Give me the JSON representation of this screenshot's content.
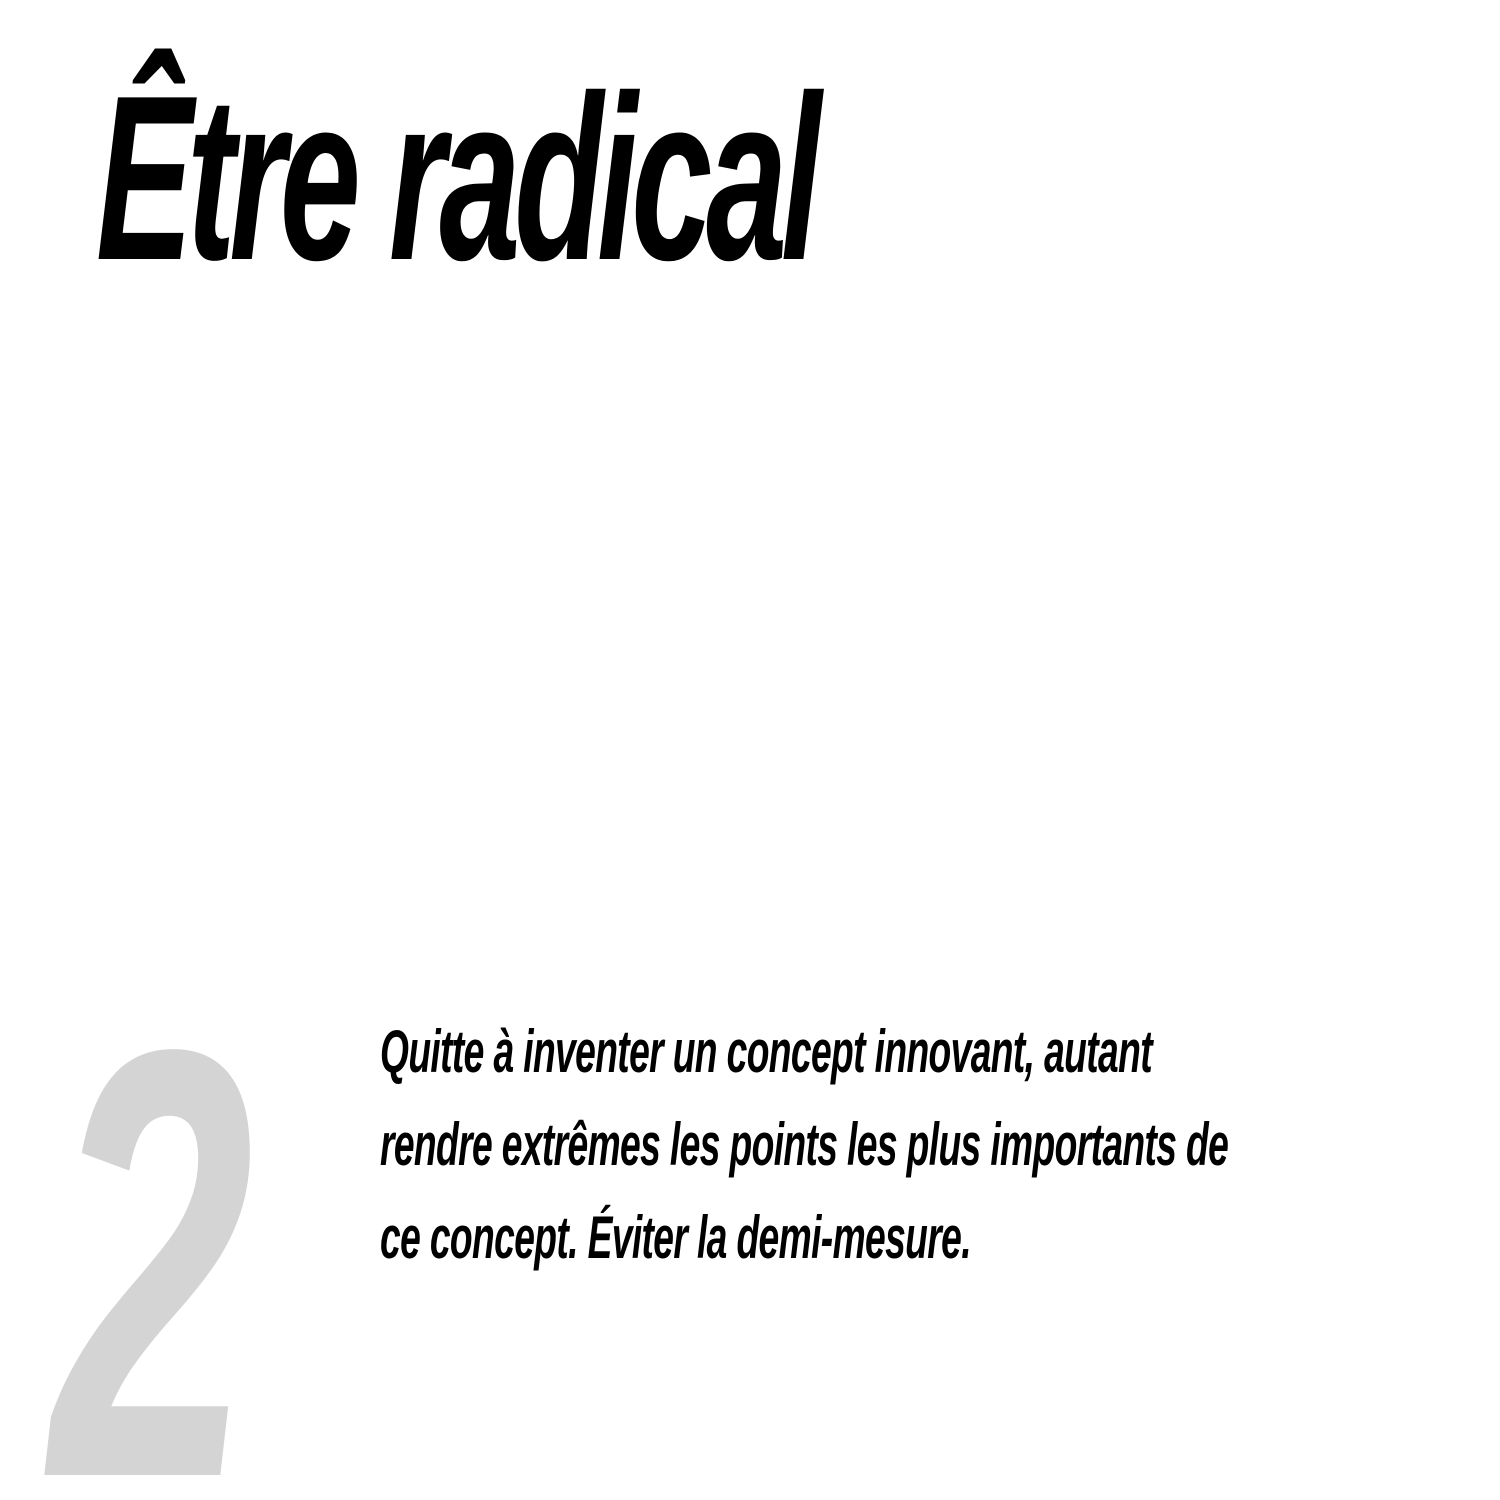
{
  "title": "Être radical",
  "number": "2",
  "body": {
    "lines": [
      "Quitte à inventer un concept innovant, autant",
      "rendre extrêmes les points les plus importants de",
      "ce concept. Éviter la demi-mesure."
    ]
  },
  "colors": {
    "text": "#000000",
    "numeral": "#d4d4d4",
    "background": "#ffffff"
  }
}
